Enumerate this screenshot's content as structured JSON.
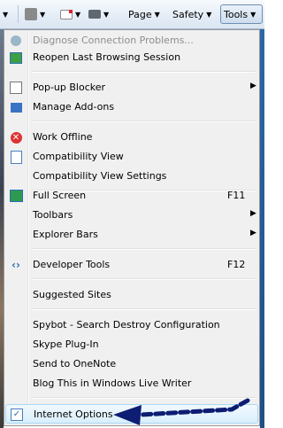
{
  "toolbar": {
    "page_label": "Page",
    "safety_label": "Safety",
    "tools_label": "Tools",
    "icons": [
      "home-icon",
      "rss-feed-icon",
      "mail-icon",
      "print-icon"
    ]
  },
  "menu": {
    "items": [
      {
        "label": "Diagnose Connection Problems...",
        "disabled": true,
        "icon": "diagnose-icon"
      },
      {
        "label": "Reopen Last Browsing Session",
        "icon": "reopen-icon"
      },
      {
        "label": "Pop-up Blocker",
        "submenu": true,
        "icon": "popup-blocker-icon"
      },
      {
        "label": "Manage Add-ons",
        "icon": "addons-icon"
      },
      {
        "label": "Work Offline",
        "icon": "work-offline-icon"
      },
      {
        "label": "Compatibility View",
        "icon": "compatibility-icon"
      },
      {
        "label": "Compatibility View Settings"
      },
      {
        "label": "Full Screen",
        "shortcut": "F11",
        "icon": "fullscreen-icon"
      },
      {
        "label": "Toolbars",
        "submenu": true
      },
      {
        "label": "Explorer Bars",
        "submenu": true
      },
      {
        "label": "Developer Tools",
        "shortcut": "F12",
        "icon": "developer-tools-icon"
      },
      {
        "label": "Suggested Sites"
      },
      {
        "label": "Spybot - Search  Destroy Configuration"
      },
      {
        "label": "Skype Plug-In"
      },
      {
        "label": "Send to OneNote"
      },
      {
        "label": "Blog This in Windows Live Writer"
      },
      {
        "label": "Internet Options",
        "highlighted": true,
        "icon": "internet-options-icon"
      }
    ]
  },
  "colors": {
    "menu_bg": "#f0f0f0",
    "highlight_border": "#a8d8f4",
    "arrow": "#0d1d73"
  }
}
